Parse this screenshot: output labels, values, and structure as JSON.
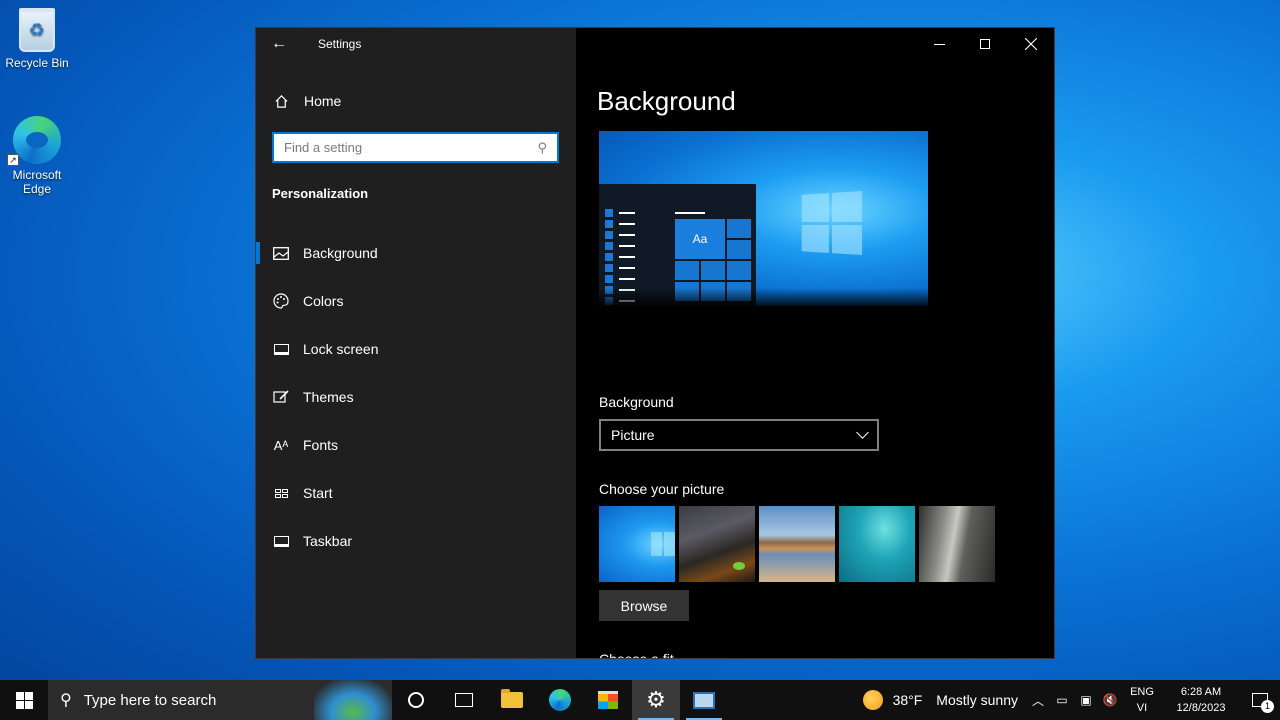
{
  "desktop": {
    "icons": [
      {
        "label": "Recycle Bin"
      },
      {
        "label": "Microsoft Edge"
      }
    ]
  },
  "window": {
    "title": "Settings",
    "nav": {
      "home": "Home",
      "search_placeholder": "Find a setting",
      "section": "Personalization",
      "items": [
        {
          "label": "Background",
          "icon": "picture-icon"
        },
        {
          "label": "Colors",
          "icon": "palette-icon"
        },
        {
          "label": "Lock screen",
          "icon": "lock-screen-icon"
        },
        {
          "label": "Themes",
          "icon": "brush-icon"
        },
        {
          "label": "Fonts",
          "icon": "fonts-icon"
        },
        {
          "label": "Start",
          "icon": "start-icon"
        },
        {
          "label": "Taskbar",
          "icon": "taskbar-icon"
        }
      ],
      "selected": "Background"
    },
    "content": {
      "page_title": "Background",
      "preview_tile_text": "Aa",
      "background_label": "Background",
      "background_value": "Picture",
      "choose_picture_label": "Choose your picture",
      "browse_label": "Browse",
      "choose_fit_label": "Choose a fit"
    }
  },
  "taskbar": {
    "search_text": "Type here to search",
    "weather_temp": "38°F",
    "weather_desc": "Mostly sunny",
    "lang_line1": "ENG",
    "lang_line2": "VI",
    "time": "6:28 AM",
    "date": "12/8/2023",
    "notification_count": "1"
  }
}
